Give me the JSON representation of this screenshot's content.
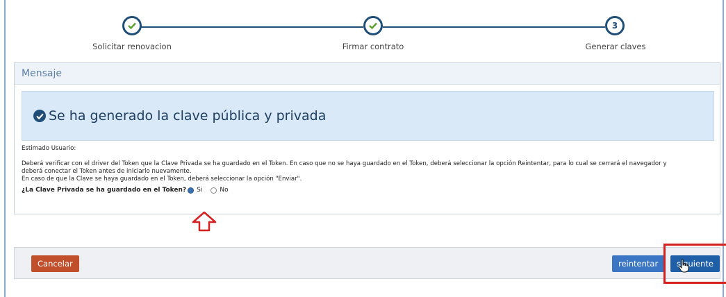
{
  "stepper": {
    "steps": [
      {
        "label": "Solicitar renovacion",
        "state": "done"
      },
      {
        "label": "Firmar contrato",
        "state": "done"
      },
      {
        "label": "Generar claves",
        "state": "current",
        "number": "3"
      }
    ]
  },
  "message": {
    "header": "Mensaje",
    "banner": "Se ha generado la clave pública y privada",
    "greeting": "Estimado Usuario:",
    "paragraph1": "Deberá verificar con el driver del Token que la Clave Privada se ha guardado en el Token. En caso que no se haya guardado en el Token, deberá seleccionar la opción Reintentar, para lo cual se cerrará el navegador y",
    "paragraph1b": "deberá conectar el Token antes de iniciarlo nuevamente.",
    "paragraph2": "En caso de que la Clave se haya guardado en el Token, deberá seleccionar la opción \"Enviar\".",
    "question": "¿La Clave Privada se ha guardado en el Token?",
    "options": [
      {
        "label": "Si",
        "selected": true
      },
      {
        "label": "No",
        "selected": false
      }
    ]
  },
  "footer": {
    "cancel_label": "Cancelar",
    "retry_label": "reintentar",
    "next_label": "siguiente"
  },
  "colors": {
    "primary": "#1f4e79",
    "cancel": "#c24f2c",
    "highlight": "#d52020"
  }
}
